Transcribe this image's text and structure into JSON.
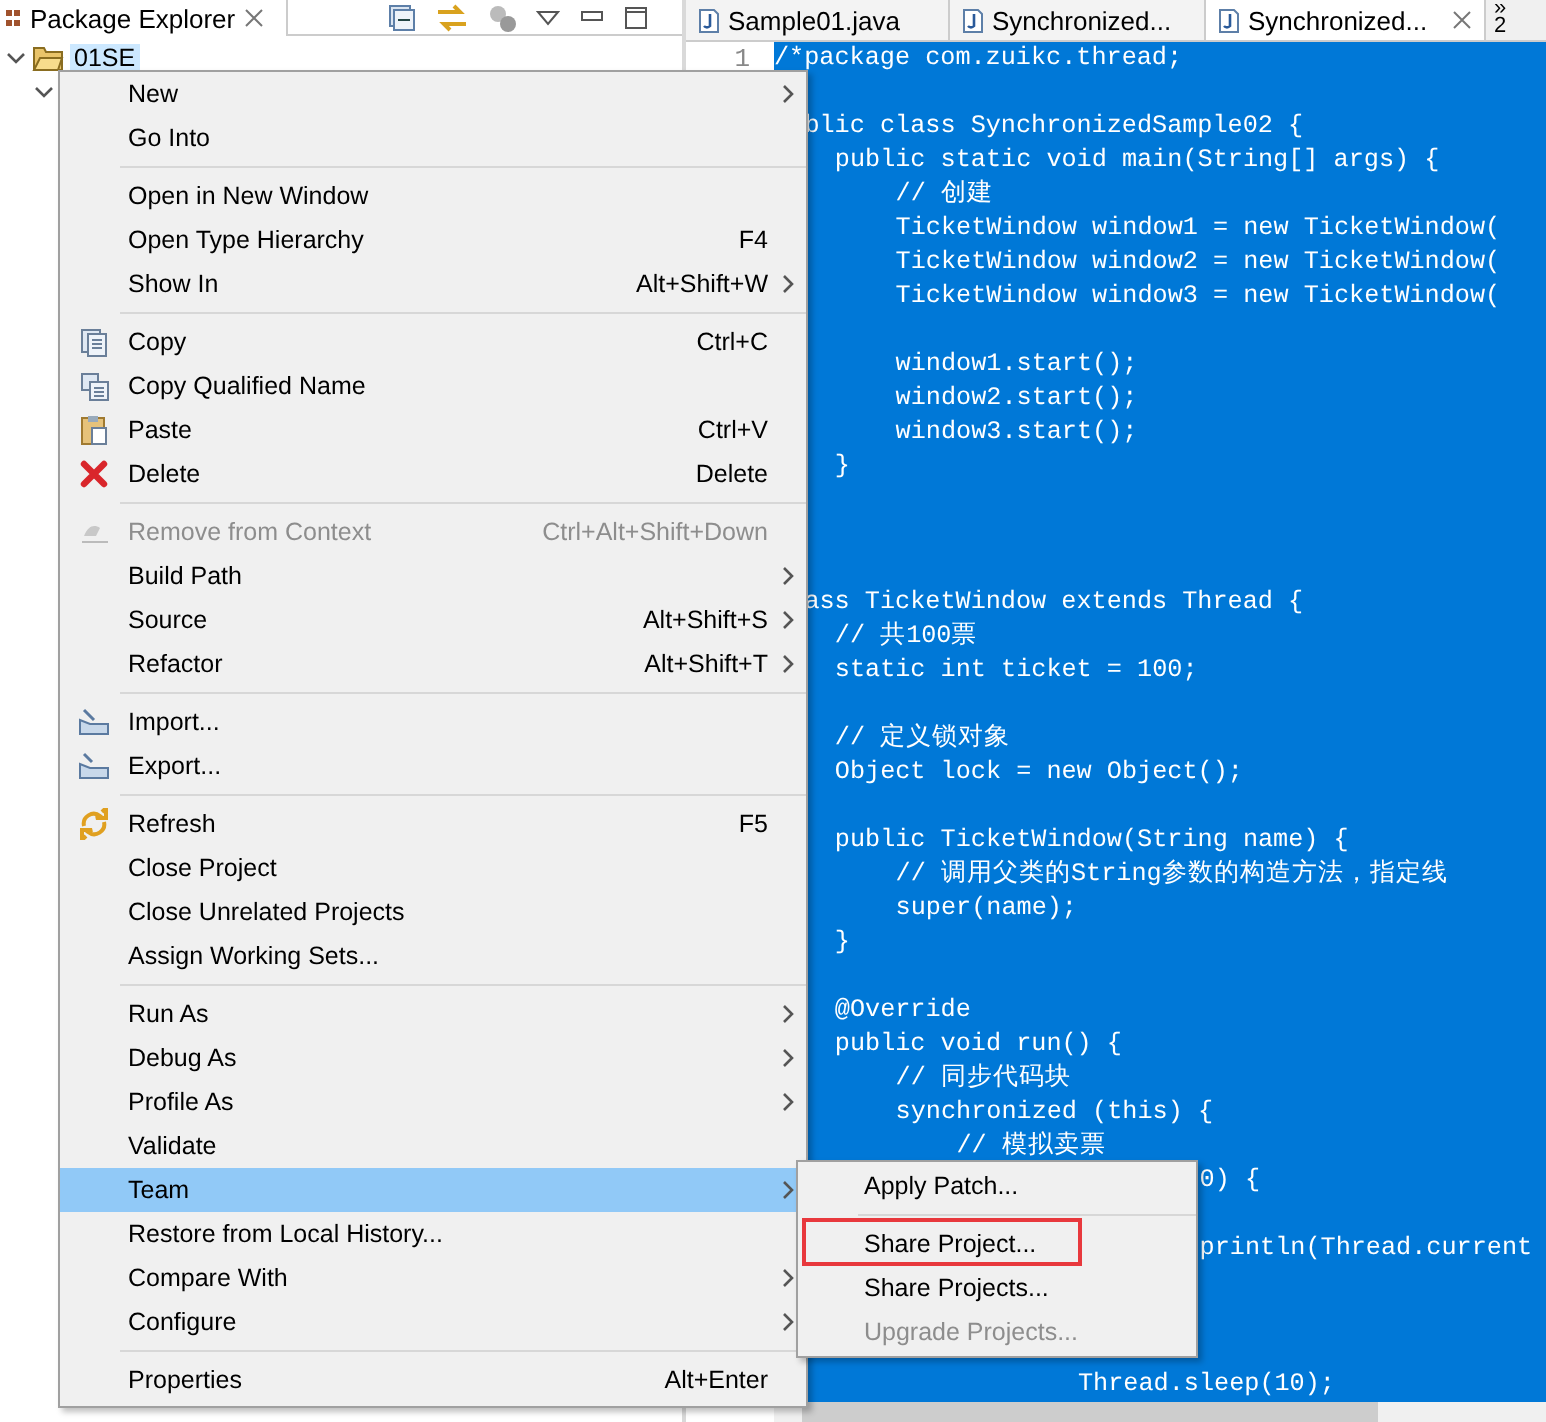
{
  "explorer": {
    "title": "Package Explorer",
    "tree": [
      {
        "label": "01SE",
        "selected": true,
        "expanded": true
      }
    ]
  },
  "editor": {
    "tabs": [
      {
        "label": "Sample01.java",
        "selected": false
      },
      {
        "label": "Synchronized...",
        "selected": false
      },
      {
        "label": "Synchronized...",
        "selected": true
      }
    ],
    "overflow": "»",
    "overflow_count": "2",
    "line_number": "1",
    "lines": [
      {
        "kind": "code",
        "text": "/*package com.zuikc.thread;"
      },
      {
        "kind": "blank"
      },
      {
        "kind": "code",
        "text": "  blic class SynchronizedSample02 {"
      },
      {
        "kind": "code",
        "text": "    public static void main(String[] args) {"
      },
      {
        "kind": "code",
        "text": "        // 创建"
      },
      {
        "kind": "code",
        "text": "        TicketWindow window1 = new TicketWindow("
      },
      {
        "kind": "code",
        "text": "        TicketWindow window2 = new TicketWindow("
      },
      {
        "kind": "code",
        "text": "        TicketWindow window3 = new TicketWindow("
      },
      {
        "kind": "blank"
      },
      {
        "kind": "code",
        "text": "        window1.start();"
      },
      {
        "kind": "code",
        "text": "        window2.start();"
      },
      {
        "kind": "code",
        "text": "        window3.start();"
      },
      {
        "kind": "code",
        "text": "    }"
      },
      {
        "kind": "blank"
      },
      {
        "kind": "blank"
      },
      {
        "kind": "blank"
      },
      {
        "kind": "code",
        "text": "  ass TicketWindow extends Thread {"
      },
      {
        "kind": "code",
        "text": "    // 共100票"
      },
      {
        "kind": "code",
        "text": "    static int ticket = 100;"
      },
      {
        "kind": "blank"
      },
      {
        "kind": "code",
        "text": "    // 定义锁对象"
      },
      {
        "kind": "code",
        "text": "    Object lock = new Object();"
      },
      {
        "kind": "blank"
      },
      {
        "kind": "code",
        "text": "    public TicketWindow(String name) {"
      },
      {
        "kind": "code",
        "text": "        // 调用父类的String参数的构造方法，指定线"
      },
      {
        "kind": "code",
        "text": "        super(name);"
      },
      {
        "kind": "code",
        "text": "    }"
      },
      {
        "kind": "blank"
      },
      {
        "kind": "code",
        "text": "    @Override"
      },
      {
        "kind": "code",
        "text": "    public void run() {"
      },
      {
        "kind": "code",
        "text": "        // 同步代码块"
      },
      {
        "kind": "code",
        "text": "        synchronized (this) {"
      },
      {
        "kind": "code",
        "text": "            // 模拟卖票"
      },
      {
        "kind": "code",
        "text": "                            0) {"
      },
      {
        "kind": "blank"
      },
      {
        "kind": "code",
        "text": "                            println(Thread.current"
      },
      {
        "kind": "blank"
      },
      {
        "kind": "blank"
      },
      {
        "kind": "blank"
      },
      {
        "kind": "code",
        "text": "                    Thread.sleep(10);"
      }
    ]
  },
  "context_menu": [
    {
      "kind": "item",
      "label": "New",
      "submenu": true
    },
    {
      "kind": "item",
      "label": "Go Into"
    },
    {
      "kind": "separator"
    },
    {
      "kind": "item",
      "label": "Open in New Window"
    },
    {
      "kind": "item",
      "label": "Open Type Hierarchy",
      "shortcut": "F4"
    },
    {
      "kind": "item",
      "label": "Show In",
      "shortcut": "Alt+Shift+W",
      "submenu": true
    },
    {
      "kind": "separator"
    },
    {
      "kind": "item",
      "label": "Copy",
      "shortcut": "Ctrl+C"
    },
    {
      "kind": "item",
      "label": "Copy Qualified Name"
    },
    {
      "kind": "item",
      "label": "Paste",
      "shortcut": "Ctrl+V"
    },
    {
      "kind": "item",
      "label": "Delete",
      "shortcut": "Delete"
    },
    {
      "kind": "separator"
    },
    {
      "kind": "item",
      "label": "Remove from Context",
      "shortcut": "Ctrl+Alt+Shift+Down",
      "disabled": true
    },
    {
      "kind": "item",
      "label": "Build Path",
      "submenu": true
    },
    {
      "kind": "item",
      "label": "Source",
      "shortcut": "Alt+Shift+S",
      "submenu": true
    },
    {
      "kind": "item",
      "label": "Refactor",
      "shortcut": "Alt+Shift+T",
      "submenu": true
    },
    {
      "kind": "separator"
    },
    {
      "kind": "item",
      "label": "Import..."
    },
    {
      "kind": "item",
      "label": "Export..."
    },
    {
      "kind": "separator"
    },
    {
      "kind": "item",
      "label": "Refresh",
      "shortcut": "F5"
    },
    {
      "kind": "item",
      "label": "Close Project"
    },
    {
      "kind": "item",
      "label": "Close Unrelated Projects"
    },
    {
      "kind": "item",
      "label": "Assign Working Sets..."
    },
    {
      "kind": "separator"
    },
    {
      "kind": "item",
      "label": "Run As",
      "submenu": true
    },
    {
      "kind": "item",
      "label": "Debug As",
      "submenu": true
    },
    {
      "kind": "item",
      "label": "Profile As",
      "submenu": true
    },
    {
      "kind": "item",
      "label": "Validate"
    },
    {
      "kind": "item",
      "label": "Team",
      "submenu": true,
      "selected": true
    },
    {
      "kind": "item",
      "label": "Restore from Local History..."
    },
    {
      "kind": "item",
      "label": "Compare With",
      "submenu": true
    },
    {
      "kind": "item",
      "label": "Configure",
      "submenu": true
    },
    {
      "kind": "separator"
    },
    {
      "kind": "item",
      "label": "Properties",
      "shortcut": "Alt+Enter"
    }
  ],
  "team_submenu": [
    {
      "kind": "item",
      "label": "Apply Patch..."
    },
    {
      "kind": "separator"
    },
    {
      "kind": "item",
      "label": "Share Project...",
      "highlighted": true
    },
    {
      "kind": "item",
      "label": "Share Projects..."
    },
    {
      "kind": "item",
      "label": "Upgrade Projects...",
      "disabled": true
    }
  ]
}
